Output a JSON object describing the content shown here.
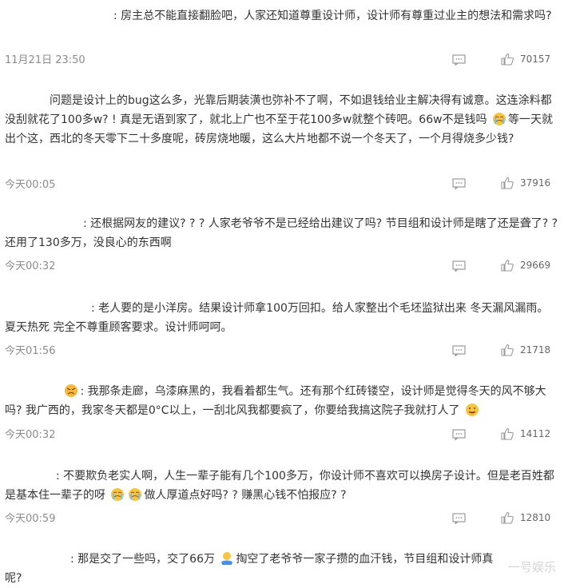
{
  "comments": [
    {
      "author": "、、",
      "text": ": 房主总不能直接翻脸吧，人家还知道尊重设计师，设计师有尊重过业主的想法和需求吗?",
      "time": "11月21日 23:50",
      "likes": "70157"
    },
    {
      "author": "",
      "text": "问题是设计上的bug这么多，光靠后期装潢也弥补不了啊，不如退钱给业主解决得有诚意。这连涂料都没刮就花了100多w? ! 真是无语到家了，就北上广也不至于花100多w就整个砖吧。66w不是钱吗",
      "text2": "等一天就出个这，西北的冬天零下二十多度呢，砖房烧地暖，这么大片地都不说一个冬天了，一个月得烧多少钱?",
      "time": "今天00:05",
      "likes": "37916"
    },
    {
      "author": "",
      "text": ": 还根据网友的建议? ? ? 人家老爷爷不是已经给出建议了吗? 节目组和设计师是瞎了还是聋了? ? 还用了130多万，没良心的东西啊",
      "time": "今天00:32",
      "likes": "29669"
    },
    {
      "author": "",
      "text": ": 老人要的是小洋房。结果设计师拿100万回扣。给人家整出个毛坯监狱出来 冬天漏风漏雨。夏天热死 完全不尊重顾客要求。设计师呵呵。",
      "time": "今天01:56",
      "likes": "21718"
    },
    {
      "author": "",
      "text": ": 我那条走廊，乌漆麻黑的，我看着都生气。还有那个红砖镂空，设计师是觉得冬天的风不够大吗? 我广西的，我家冬天都是0°C以上，一刮北风我都要疯了，你要给我搞这院子我就打人了",
      "time": "今天00:32",
      "likes": "14112"
    },
    {
      "author": "",
      "text": ": 不要欺负老实人啊，人生一辈子能有几个100多万，你设计师不喜欢可以换房子设计。但是老百姓都是基本住一辈子的呀",
      "text2": "做人厚道点好吗? ? 赚黑心钱不怕报应? ?",
      "time": "今天00:59",
      "likes": "12810"
    },
    {
      "author": "",
      "text": ": 那是交了一些吗，交了66万",
      "text2": "掏空了老爷爷一家子攒的血汗钱，节目组和设计师真",
      "text3": "呢?",
      "time": "",
      "likes": ""
    }
  ],
  "watermark": "一号娱乐",
  "colors": {
    "text": "#333333",
    "meta": "#8c8c8c",
    "icon": "#999999",
    "emoji": "#f5c542"
  }
}
